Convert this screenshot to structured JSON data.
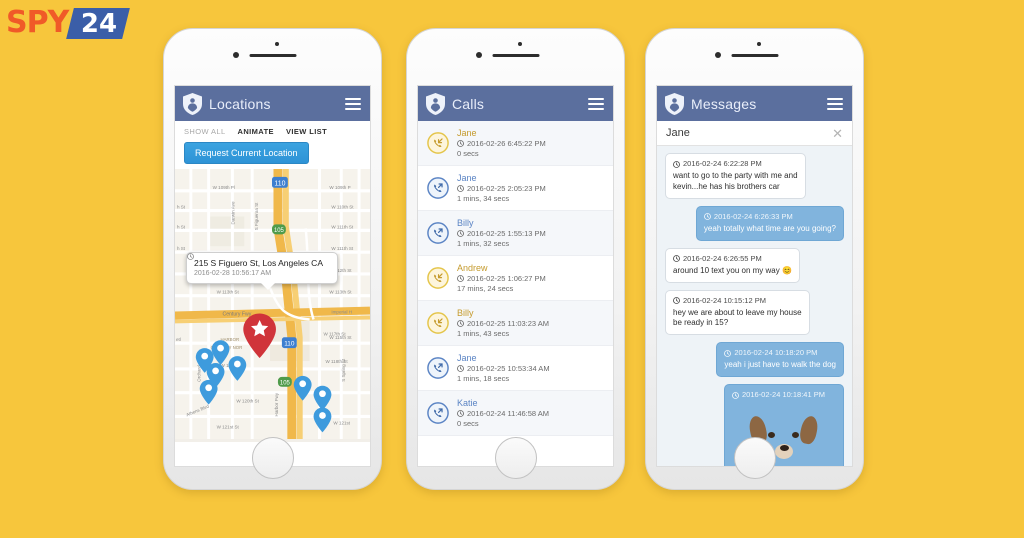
{
  "brand": {
    "part1": "SPY",
    "part2": "24"
  },
  "theme": {
    "page_background": "#f7c63c",
    "appbar": "#5b6f9e",
    "button_blue": "#3ba3e0",
    "bubble_out": "#81b4dd",
    "call_incoming": "#e4c54a",
    "call_outgoing": "#5b84c4",
    "marker_blue": "#3e9bdd",
    "marker_red": "#d0343a"
  },
  "phone_locations": {
    "appbar": {
      "title": "Locations",
      "shield_icon": "shield-icon",
      "menu_icon": "hamburger-menu-icon"
    },
    "tabs": [
      {
        "label": "SHOW ALL",
        "active": false
      },
      {
        "label": "ANIMATE",
        "active": true
      },
      {
        "label": "VIEW LIST",
        "active": true
      }
    ],
    "request_button": "Request Current Location",
    "callout": {
      "address": "215 S Figuero St, Los Angeles CA",
      "timestamp": "2016-02-28 10:56:17 AM",
      "clock_icon": "clock-icon"
    },
    "map": {
      "street_labels": [
        "W 109th Pl",
        "W 109th Pl",
        "W 110th St",
        "W 111th St",
        "W 111th St",
        "W 112th St",
        "W 112th St",
        "W 113th St",
        "W 113th St",
        "S Figueroa St",
        "Darwin Ave",
        "Harbor Fwy",
        "Century Fwy",
        "W 117th St",
        "W 118th St",
        "W 118th St",
        "W 120th St",
        "W 121st St",
        "W 121st St",
        "Athens Blvd",
        "Orchard Ave",
        "S Spring St",
        "Imperial H",
        "HARBOR GATEWAY NOR",
        "W 115th St"
      ],
      "highway_shields": [
        "110",
        "105"
      ],
      "current_marker": "star-location-marker",
      "history_markers": 8
    }
  },
  "phone_calls": {
    "appbar": {
      "title": "Calls",
      "shield_icon": "shield-icon",
      "menu_icon": "hamburger-menu-icon"
    },
    "entries": [
      {
        "name": "Jane",
        "timestamp": "2016-02-26 6:45:22 PM",
        "duration": "0 secs",
        "direction": "incoming"
      },
      {
        "name": "Jane",
        "timestamp": "2016-02-25 2:05:23 PM",
        "duration": "1 mins, 34 secs",
        "direction": "outgoing"
      },
      {
        "name": "Billy",
        "timestamp": "2016-02-25 1:55:13 PM",
        "duration": "1 mins, 32 secs",
        "direction": "outgoing"
      },
      {
        "name": "Andrew",
        "timestamp": "2016-02-25 1:06:27 PM",
        "duration": "17 mins, 24 secs",
        "direction": "incoming"
      },
      {
        "name": "Billy",
        "timestamp": "2016-02-25 11:03:23 AM",
        "duration": "1 mins, 43 secs",
        "direction": "incoming"
      },
      {
        "name": "Jane",
        "timestamp": "2016-02-25 10:53:34 AM",
        "duration": "1 mins, 18 secs",
        "direction": "outgoing"
      },
      {
        "name": "Katie",
        "timestamp": "2016-02-24 11:46:58 AM",
        "duration": "0 secs",
        "direction": "outgoing"
      }
    ]
  },
  "phone_messages": {
    "appbar": {
      "title": "Messages",
      "shield_icon": "shield-icon",
      "menu_icon": "hamburger-menu-icon"
    },
    "conversation": {
      "name": "Jane",
      "close_label": "✕"
    },
    "bubbles": [
      {
        "side": "in",
        "timestamp": "2016-02-24 6:22:28 PM",
        "text": "want to go to the party with me and\nkevin...he has his brothers car"
      },
      {
        "side": "out",
        "timestamp": "2016-02-24 6:26:33 PM",
        "text": "yeah totally what time are you going?"
      },
      {
        "side": "in",
        "timestamp": "2016-02-24 6:26:55 PM",
        "text": "around 10 text you on my way 😊"
      },
      {
        "side": "in",
        "timestamp": "2016-02-24 10:15:12 PM",
        "text": "hey we are about to leave my house\nbe ready in 15?"
      },
      {
        "side": "out",
        "timestamp": "2016-02-24 10:18:20 PM",
        "text": "yeah i just have to walk the dog"
      },
      {
        "side": "out",
        "timestamp": "2016-02-24 10:18:41 PM",
        "text": "",
        "attachment": "dog-photo"
      }
    ]
  }
}
